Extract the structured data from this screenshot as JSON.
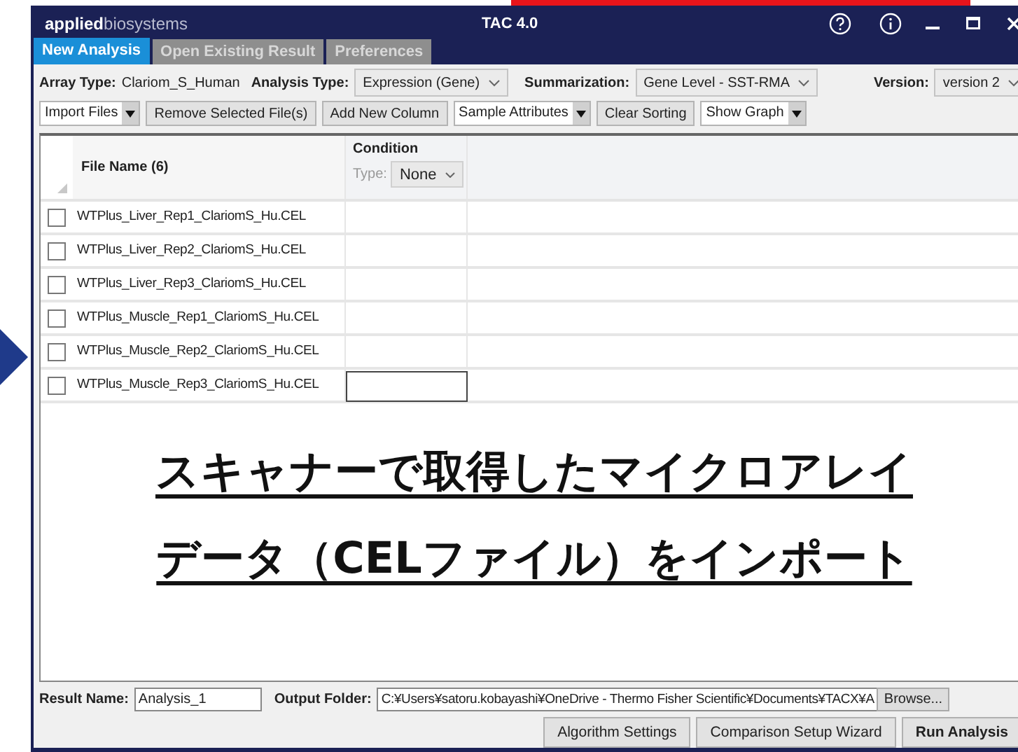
{
  "window": {
    "brand": "**applied**biosystems",
    "title": "TAC 4.0"
  },
  "tabs": [
    {
      "label": "New Analysis",
      "selected": true
    },
    {
      "label": "Open Existing Result",
      "selected": false
    },
    {
      "label": "Preferences",
      "selected": false
    }
  ],
  "settings": {
    "array_type": {
      "label": "Array Type:",
      "value": "Clariom_S_Human"
    },
    "analysis_type": {
      "label": "Analysis Type:",
      "value": "Expression (Gene)"
    },
    "summarization": {
      "label": "Summarization:",
      "value": "Gene Level - SST-RMA"
    },
    "version": {
      "label": "Version:",
      "value": "version 2"
    }
  },
  "toolbar": [
    {
      "kind": "dropdown",
      "label": "Import Files"
    },
    {
      "kind": "button",
      "label": "Remove Selected File(s)"
    },
    {
      "kind": "button",
      "label": "Add New Column"
    },
    {
      "kind": "dropdown",
      "label": "Sample Attributes"
    },
    {
      "kind": "button",
      "label": "Clear Sorting"
    },
    {
      "kind": "dropdown",
      "label": "Show Graph"
    }
  ],
  "table": {
    "file_column": "File Name (6)",
    "condition_column": {
      "title": "Condition",
      "type_label": "Type:",
      "type_value": "None"
    },
    "rows": [
      {
        "name": "WTPlus_Liver_Rep1_ClariomS_Hu.CEL",
        "checked": false,
        "editing": false
      },
      {
        "name": "WTPlus_Liver_Rep2_ClariomS_Hu.CEL",
        "checked": false,
        "editing": false
      },
      {
        "name": "WTPlus_Liver_Rep3_ClariomS_Hu.CEL",
        "checked": false,
        "editing": false
      },
      {
        "name": "WTPlus_Muscle_Rep1_ClariomS_Hu.CEL",
        "checked": false,
        "editing": false
      },
      {
        "name": "WTPlus_Muscle_Rep2_ClariomS_Hu.CEL",
        "checked": false,
        "editing": false
      },
      {
        "name": "WTPlus_Muscle_Rep3_ClariomS_Hu.CEL",
        "checked": false,
        "editing": true
      }
    ]
  },
  "caption": [
    "スキャナーで取得したマイクロアレイ",
    "データ（CELファイル）をインポート"
  ],
  "footer": {
    "result_name": {
      "label": "Result Name:",
      "value": "Analysis_1"
    },
    "output_folder": {
      "label": "Output Folder:",
      "value": "C:¥Users¥satoru.kobayashi¥OneDrive - Thermo Fisher Scientific¥Documents¥TACX¥A",
      "browse": "Browse..."
    },
    "buttons": [
      {
        "label": "Algorithm Settings",
        "primary": false
      },
      {
        "label": "Comparison Setup Wizard",
        "primary": false
      },
      {
        "label": "Run Analysis",
        "primary": true
      }
    ]
  }
}
